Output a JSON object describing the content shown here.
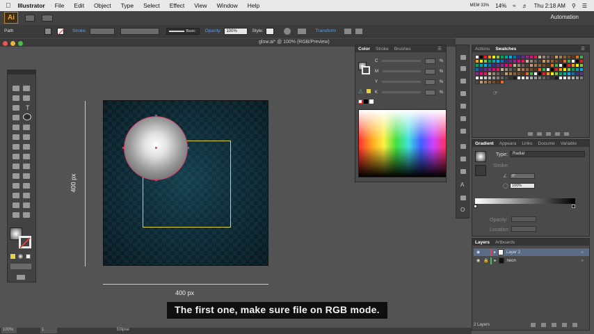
{
  "menubar": {
    "app": "Illustrator",
    "items": [
      "File",
      "Edit",
      "Object",
      "Type",
      "Select",
      "Effect",
      "View",
      "Window",
      "Help"
    ],
    "battery_pct": "14%",
    "mem": "MEM 33%",
    "clock": "Thu 2:18 AM"
  },
  "appbar": {
    "logo": "Ai",
    "workspace": "Automation"
  },
  "controlbar": {
    "selection": "Path",
    "stroke_label": "Stroke:",
    "brush_preset": "Basic",
    "opacity_label": "Opacity:",
    "opacity_value": "100%",
    "style_label": "Style:",
    "transform_link": "Transform"
  },
  "document": {
    "tab_title": "glow.ai* @ 100% (RGB/Preview)"
  },
  "artboard": {
    "height_label": "400 px",
    "width_label": "400 px"
  },
  "color_panel": {
    "tabs": [
      "Color",
      "Stroke",
      "Brushes"
    ],
    "channels": [
      "C",
      "M",
      "Y",
      "K"
    ],
    "percent": "%"
  },
  "swatch_panel": {
    "tabs": [
      "Actions",
      "Swatches"
    ]
  },
  "gradient_panel": {
    "tabs": [
      "Gradient",
      "Appeara",
      "Links",
      "Docume",
      "Variable"
    ],
    "type_label": "Type:",
    "type_value": "Radial",
    "stroke_label": "Stroke:",
    "angle_value": "0°",
    "ratio_value": "100%",
    "opacity_label": "Opacity:",
    "location_label": "Location:"
  },
  "layers_panel": {
    "tabs": [
      "Layers",
      "Artboards"
    ],
    "layers": [
      {
        "name": "Layer 2",
        "color": "#e04060"
      },
      {
        "name": "neon",
        "color": "#40c060"
      }
    ],
    "footer": "2 Layers"
  },
  "statusbar": {
    "zoom": "100%",
    "page": "1",
    "tool": "Ellipse"
  },
  "caption": "The first one, make sure file on RGB mode."
}
